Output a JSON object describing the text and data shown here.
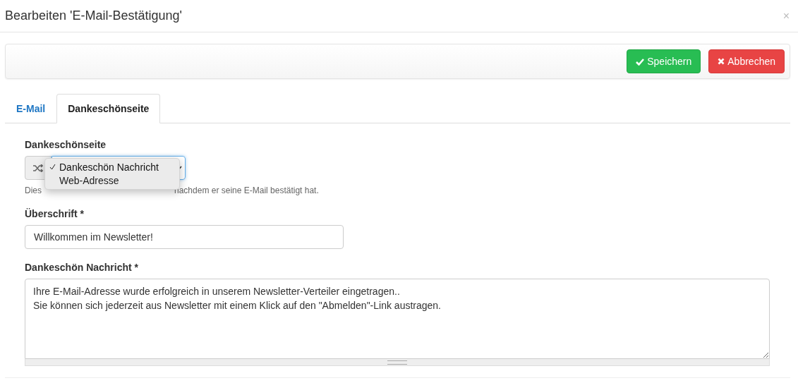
{
  "window": {
    "title": "Bearbeiten 'E-Mail-Bestätigung'",
    "close": "×"
  },
  "toolbar": {
    "buttons": [
      {
        "kind": "save",
        "label": "Speichern"
      },
      {
        "kind": "cancel",
        "label": "Abbrechen"
      }
    ]
  },
  "tabs": [
    {
      "label": "E-Mail",
      "selected": false
    },
    {
      "label": "Dankeschönseite",
      "selected": true
    }
  ],
  "page_type": {
    "label": "Dankeschönseite",
    "hint_start": "Dies",
    "hint_end": "nachdem er seine E-Mail bestätigt hat.",
    "dropdown": {
      "options": [
        {
          "label": "Dankeschön Nachricht",
          "selected": true
        },
        {
          "label": "Web-Adresse",
          "selected": false
        }
      ]
    }
  },
  "heading_field": {
    "label": "Überschrift *",
    "value": "Willkommen im Newsletter!"
  },
  "message_field": {
    "label": "Dankeschön Nachricht *",
    "value": "Ihre E-Mail-Adresse wurde erfolgreich in unserem Newsletter-Verteiler eingetragen..\nSie können sich jederzeit aus Newsletter mit einem Klick auf den \"Abmelden\"-Link austragen."
  }
}
